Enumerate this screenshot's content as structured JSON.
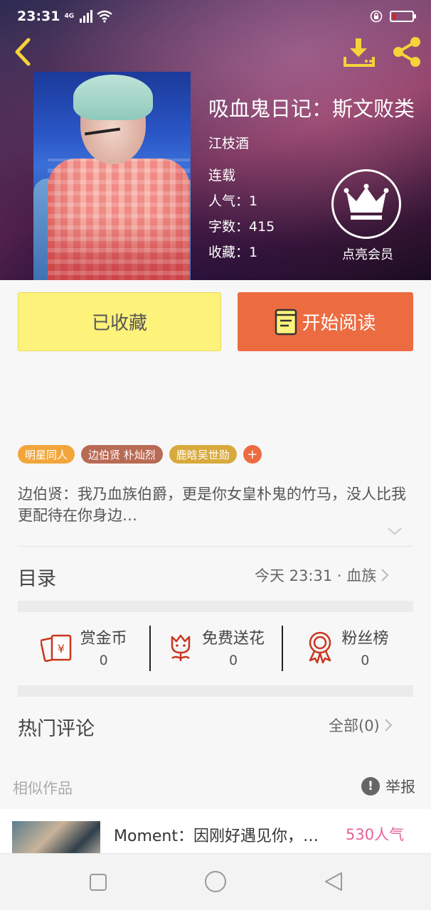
{
  "status_bar": {
    "time": "23:31",
    "network": "4G"
  },
  "book": {
    "title": "吸血鬼日记：斯文败类",
    "author": "江枝酒",
    "status": "连载",
    "popularity": "人气：1",
    "word_count": "字数：415",
    "favorites": "收藏：1"
  },
  "vip": {
    "label": "点亮会员"
  },
  "actions": {
    "favorited_label": "已收藏",
    "read_label": "开始阅读"
  },
  "tags": [
    {
      "label": "明星同人",
      "color": "#f2a63a"
    },
    {
      "label": "边伯贤 朴灿烈",
      "color": "#b96a54"
    },
    {
      "label": "鹿晗吴世勋",
      "color": "#d8a93c"
    }
  ],
  "tag_add": "+",
  "description": "边伯贤：我乃血族伯爵，更是你女皇朴鬼的竹马，没人比我更配待在你身边…",
  "catalog": {
    "label": "目录",
    "latest": "今天 23:31 · 血族"
  },
  "stats": [
    {
      "name": "赏金币",
      "value": "0",
      "icon": "red-envelope-icon"
    },
    {
      "name": "免费送花",
      "value": "0",
      "icon": "flower-icon"
    },
    {
      "name": "粉丝榜",
      "value": "0",
      "icon": "medal-icon"
    }
  ],
  "comments": {
    "label": "热门评论",
    "all": "全部(0)"
  },
  "similar": {
    "label": "相似作品",
    "report": "举报",
    "report_icon": "!",
    "items": [
      {
        "title": "Moment：因刚好遇见你，…",
        "popularity": "530人气"
      }
    ]
  },
  "colors": {
    "accent_orange": "#ec6b40",
    "fav_yellow": "#fdf27a",
    "icon_yellow": "#f5d33a",
    "stat_red": "#c8361e"
  }
}
